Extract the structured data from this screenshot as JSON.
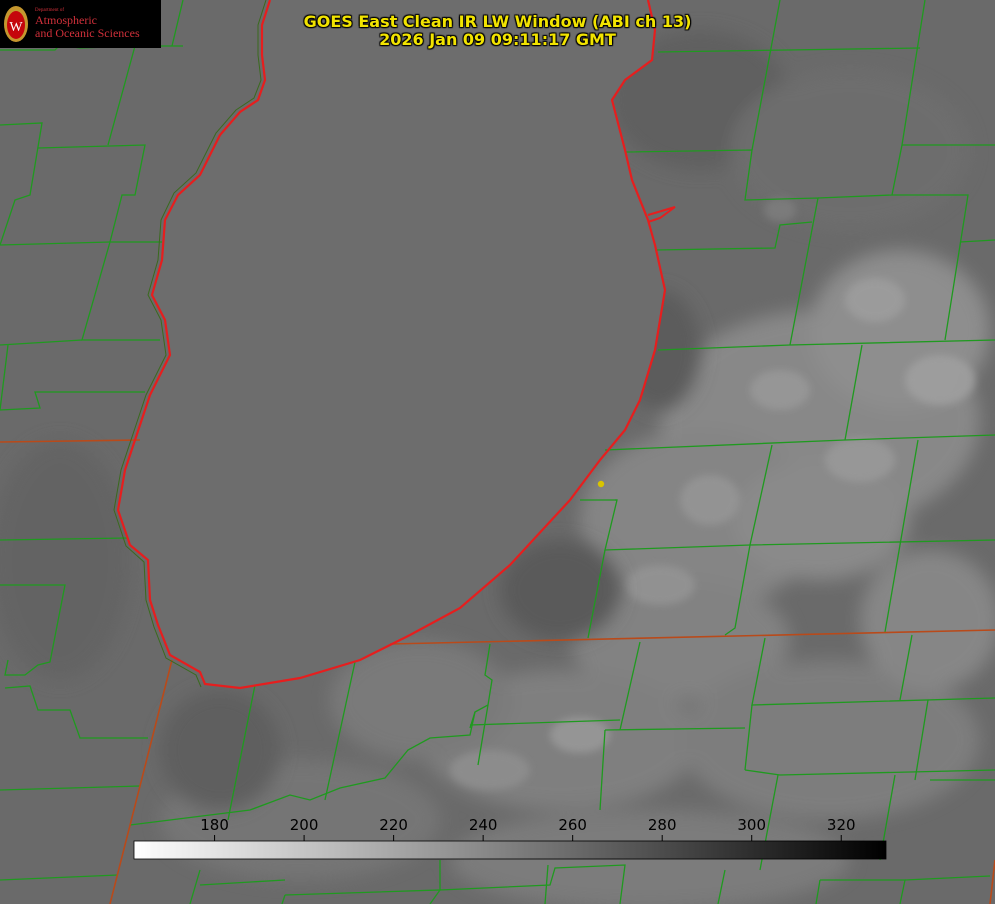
{
  "title": {
    "line1": "GOES East Clean IR LW Window (ABI ch 13)",
    "line2": "2026 Jan 09 09:11:17 GMT"
  },
  "logo": {
    "department": "Department of",
    "line1": "Atmospheric",
    "line2": "and Oceanic Sciences",
    "seal_letter": "W"
  },
  "colorbar": {
    "ticks": [
      "180",
      "200",
      "220",
      "240",
      "260",
      "280",
      "300",
      "320"
    ],
    "tick_values": [
      180,
      200,
      220,
      240,
      260,
      280,
      300,
      320
    ],
    "range": [
      162,
      330
    ],
    "gradient": "white-to-black"
  },
  "colors": {
    "title": "#f2e400",
    "county_lines": "#1f9a1f",
    "state_lines": "#b94a1a",
    "lake_outline": "#e61e1e",
    "marker": "#d8c400",
    "lake_fill": "#6b6b6b",
    "logo_red": "#d0303a"
  },
  "marker": {
    "icon": "site-marker-dot"
  }
}
